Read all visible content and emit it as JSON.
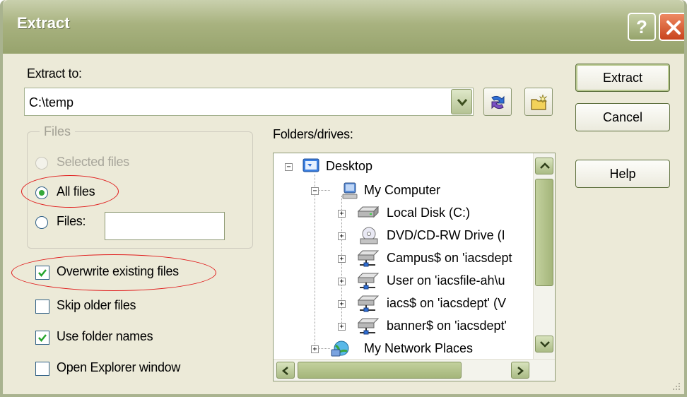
{
  "window": {
    "title": "Extract"
  },
  "titlebar_buttons": {
    "help_glyph": "?",
    "close_glyph": "✕"
  },
  "extract_to": {
    "label": "Extract to:",
    "path_value": "C:\\temp"
  },
  "buttons": {
    "extract": "Extract",
    "cancel": "Cancel",
    "help": "Help"
  },
  "files_group": {
    "title": "Files",
    "options": [
      {
        "label": "Selected files",
        "selected": false,
        "enabled": false
      },
      {
        "label": "All files",
        "selected": true,
        "enabled": true
      },
      {
        "label": "Files:",
        "selected": false,
        "enabled": true
      }
    ],
    "files_input_value": ""
  },
  "checkboxes": [
    {
      "label": "Overwrite existing files",
      "checked": true
    },
    {
      "label": "Skip older files",
      "checked": false
    },
    {
      "label": "Use folder names",
      "checked": true
    },
    {
      "label": "Open Explorer window",
      "checked": false
    }
  ],
  "folders": {
    "label": "Folders/drives:",
    "tree": [
      {
        "label": "Desktop",
        "icon": "desktop-icon",
        "expanded": true
      },
      {
        "label": "My Computer",
        "icon": "computer-icon",
        "expanded": true
      },
      {
        "label": "Local Disk (C:)",
        "icon": "hard-disk-icon"
      },
      {
        "label": "DVD/CD-RW Drive (I",
        "icon": "optical-drive-icon"
      },
      {
        "label": "Campus$ on 'iacsdept",
        "icon": "network-drive-icon"
      },
      {
        "label": "User on 'iacsfile-ah\\u",
        "icon": "network-drive-icon"
      },
      {
        "label": "iacs$ on 'iacsdept' (V",
        "icon": "network-drive-icon"
      },
      {
        "label": "banner$ on 'iacsdept'",
        "icon": "network-drive-icon"
      },
      {
        "label": "My Network Places",
        "icon": "network-places-icon"
      }
    ]
  },
  "colors": {
    "annotation": "#e01a1a",
    "window_bg": "#ecead8",
    "titlebar": "#a8b27f"
  }
}
